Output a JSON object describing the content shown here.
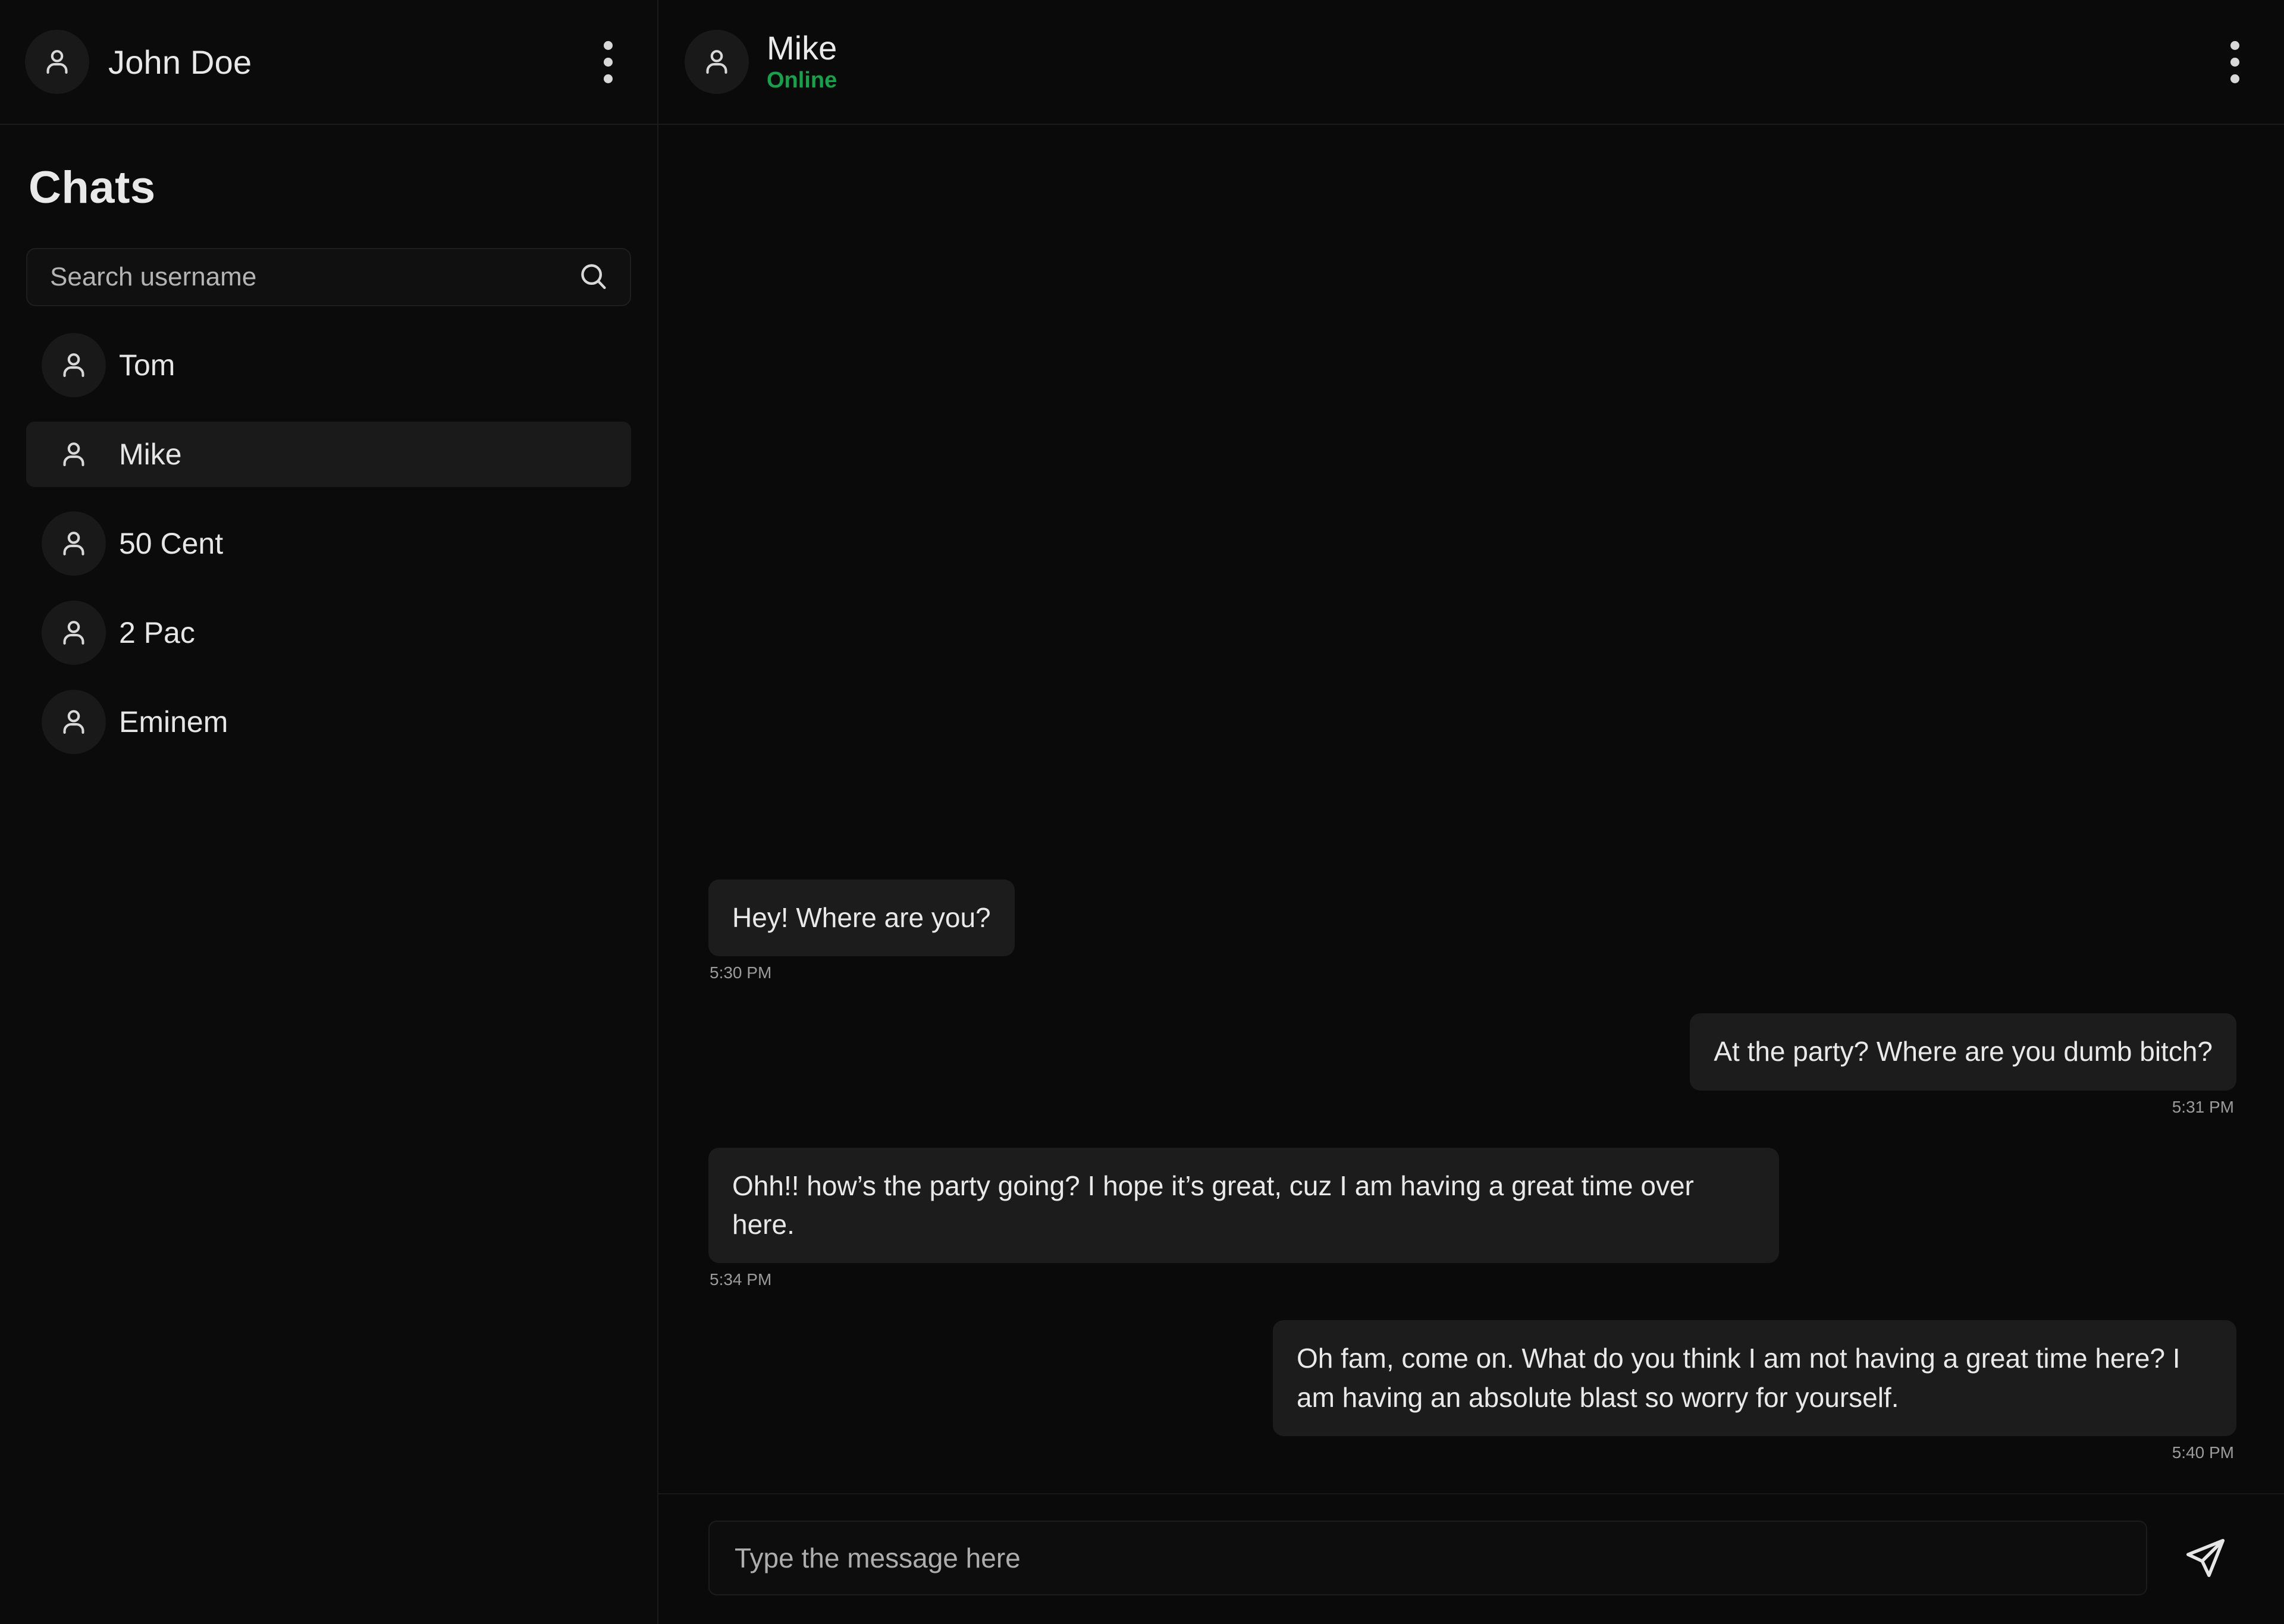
{
  "colors": {
    "page_background": "#0a0a0a",
    "bubble": "#1c1c1c",
    "selected_item": "#1a1a1a",
    "online_green": "#13a34a",
    "timestamp_grey": "#9b9b9b"
  },
  "sidebar": {
    "user": {
      "name": "John Doe",
      "avatar_icon": "person-icon"
    },
    "menu_icon": "kebab-menu-icon",
    "title": "Chats",
    "search": {
      "placeholder": "Search username",
      "value": "",
      "icon": "search-icon"
    },
    "chats": [
      {
        "name": "Tom",
        "selected": false,
        "avatar_icon": "person-icon"
      },
      {
        "name": "Mike",
        "selected": true,
        "avatar_icon": "person-icon"
      },
      {
        "name": "50 Cent",
        "selected": false,
        "avatar_icon": "person-icon"
      },
      {
        "name": "2 Pac",
        "selected": false,
        "avatar_icon": "person-icon"
      },
      {
        "name": "Eminem",
        "selected": false,
        "avatar_icon": "person-icon"
      }
    ]
  },
  "chat": {
    "peer": {
      "name": "Mike",
      "status": "Online",
      "avatar_icon": "person-icon"
    },
    "menu_icon": "kebab-menu-icon",
    "messages": [
      {
        "direction": "incoming",
        "text": "Hey! Where are you?",
        "time": "5:30 PM"
      },
      {
        "direction": "outgoing",
        "text": "At the party? Where are you dumb bitch?",
        "time": "5:31 PM"
      },
      {
        "direction": "incoming",
        "text": "Ohh!! how’s the party going? I hope it’s great, cuz I am having a great time over here.",
        "time": "5:34 PM"
      },
      {
        "direction": "outgoing",
        "text": "Oh fam, come on. What do you think I am not having a great time here? I am having an absolute blast so worry for yourself.",
        "time": "5:40 PM"
      }
    ],
    "composer": {
      "placeholder": "Type the message here",
      "value": "",
      "send_icon": "send-paper-plane-icon"
    }
  }
}
